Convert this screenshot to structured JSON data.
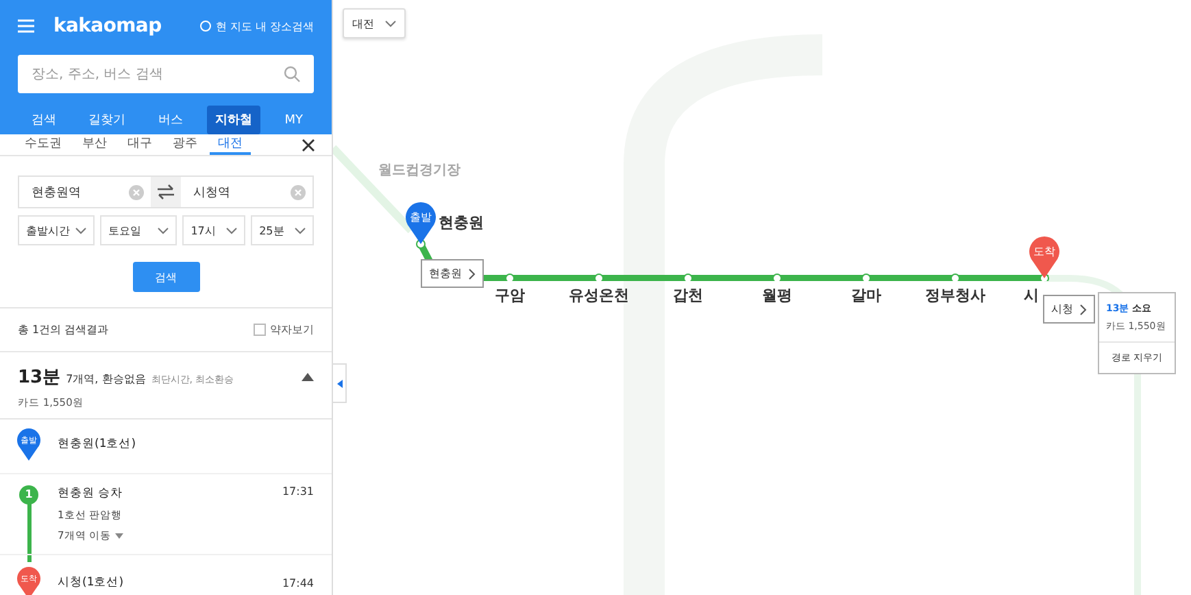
{
  "header": {
    "logo": "kakaomap",
    "area_search": {
      "label": "현 지도 내 장소검색",
      "checked": false
    }
  },
  "search": {
    "placeholder": "장소, 주소, 버스 검색"
  },
  "nav_tabs": [
    {
      "label": "검색",
      "selected": false
    },
    {
      "label": "길찾기",
      "selected": false
    },
    {
      "label": "버스",
      "selected": false
    },
    {
      "label": "지하철",
      "selected": true
    },
    {
      "label": "MY",
      "selected": false
    }
  ],
  "region_tabs": [
    {
      "label": "수도권",
      "selected": false
    },
    {
      "label": "부산",
      "selected": false
    },
    {
      "label": "대구",
      "selected": false
    },
    {
      "label": "광주",
      "selected": false
    },
    {
      "label": "대전",
      "selected": true
    }
  ],
  "route_form": {
    "origin": "현충원역",
    "destination": "시청역",
    "selects": [
      "출발시간",
      "토요일",
      "17시",
      "25분"
    ],
    "search_button": "검색"
  },
  "results": {
    "summary": "총 1건의 검색결과",
    "abbrev_toggle": {
      "label": "약자보기",
      "checked": false
    }
  },
  "route": {
    "duration": "13분",
    "info": "7개역, 환승없음",
    "tags": "최단시간, 최소환승",
    "fare": "카드 1,550원",
    "expanded": true
  },
  "steps": [
    {
      "kind": "start",
      "marker": "출발",
      "name": "현충원(1호선)"
    },
    {
      "kind": "ride",
      "marker": "1",
      "name": "현충원 승차",
      "time": "17:31",
      "direction": "1호선 판암행",
      "stops": "7개역 이동"
    },
    {
      "kind": "end",
      "marker": "도착",
      "name": "시청(1호선)",
      "time": "17:44"
    }
  ],
  "map": {
    "city_select": "대전",
    "landmark": "월드컵경기장",
    "start_marker": "출발",
    "end_marker": "도착",
    "stations": [
      {
        "name": "현충원",
        "kind": "start"
      },
      {
        "name": "구암",
        "kind": "mid"
      },
      {
        "name": "유성온천",
        "kind": "mid"
      },
      {
        "name": "갑천",
        "kind": "mid"
      },
      {
        "name": "월평",
        "kind": "mid"
      },
      {
        "name": "갈마",
        "kind": "mid"
      },
      {
        "name": "정부청사",
        "kind": "mid"
      },
      {
        "name": "시",
        "kind": "end"
      }
    ],
    "start_callout": "현충원",
    "end_callout": "시청",
    "info_popup": {
      "duration": "13분",
      "suffix": "소요",
      "fare": "카드 1,550원",
      "clear": "경로 지우기"
    }
  }
}
